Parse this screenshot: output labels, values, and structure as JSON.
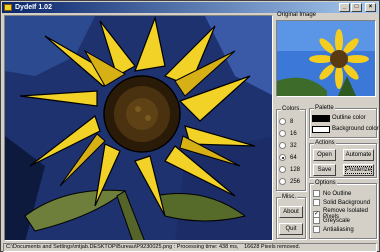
{
  "window": {
    "title": "DydeIf 1.02"
  },
  "titlebar_buttons": [
    "_",
    "□",
    "×"
  ],
  "original_image": {
    "label": "Original Image"
  },
  "colors": {
    "label": "Colors",
    "options": [
      "8",
      "16",
      "32",
      "64",
      "128",
      "256"
    ],
    "selected": "64"
  },
  "palette": {
    "label": "Palette",
    "outline_label": "Outline color",
    "outline_color": "#000000",
    "background_label": "Background color",
    "background_color": "#ffffff"
  },
  "actions": {
    "label": "Actions",
    "open": "Open",
    "automate": "Automate",
    "save": "Save",
    "posterize": "Posterize"
  },
  "options": {
    "label": "Options",
    "items": [
      {
        "label": "No Outline",
        "checked": false
      },
      {
        "label": "Solid Background",
        "checked": false
      },
      {
        "label": "Remove Isolated Pixels",
        "checked": true
      },
      {
        "label": "Greyscale",
        "checked": false
      },
      {
        "label": "Antialiasing",
        "checked": false
      }
    ]
  },
  "misc": {
    "label": "Misc.",
    "about": "About",
    "quit": "Quit"
  },
  "status": {
    "path": "C:\\Documents and Settings\\mtjab.DESKTOP\\Bureau\\P9230025.png : Processing time: 438 ms,",
    "pixels": "16628 Pixels removed."
  }
}
